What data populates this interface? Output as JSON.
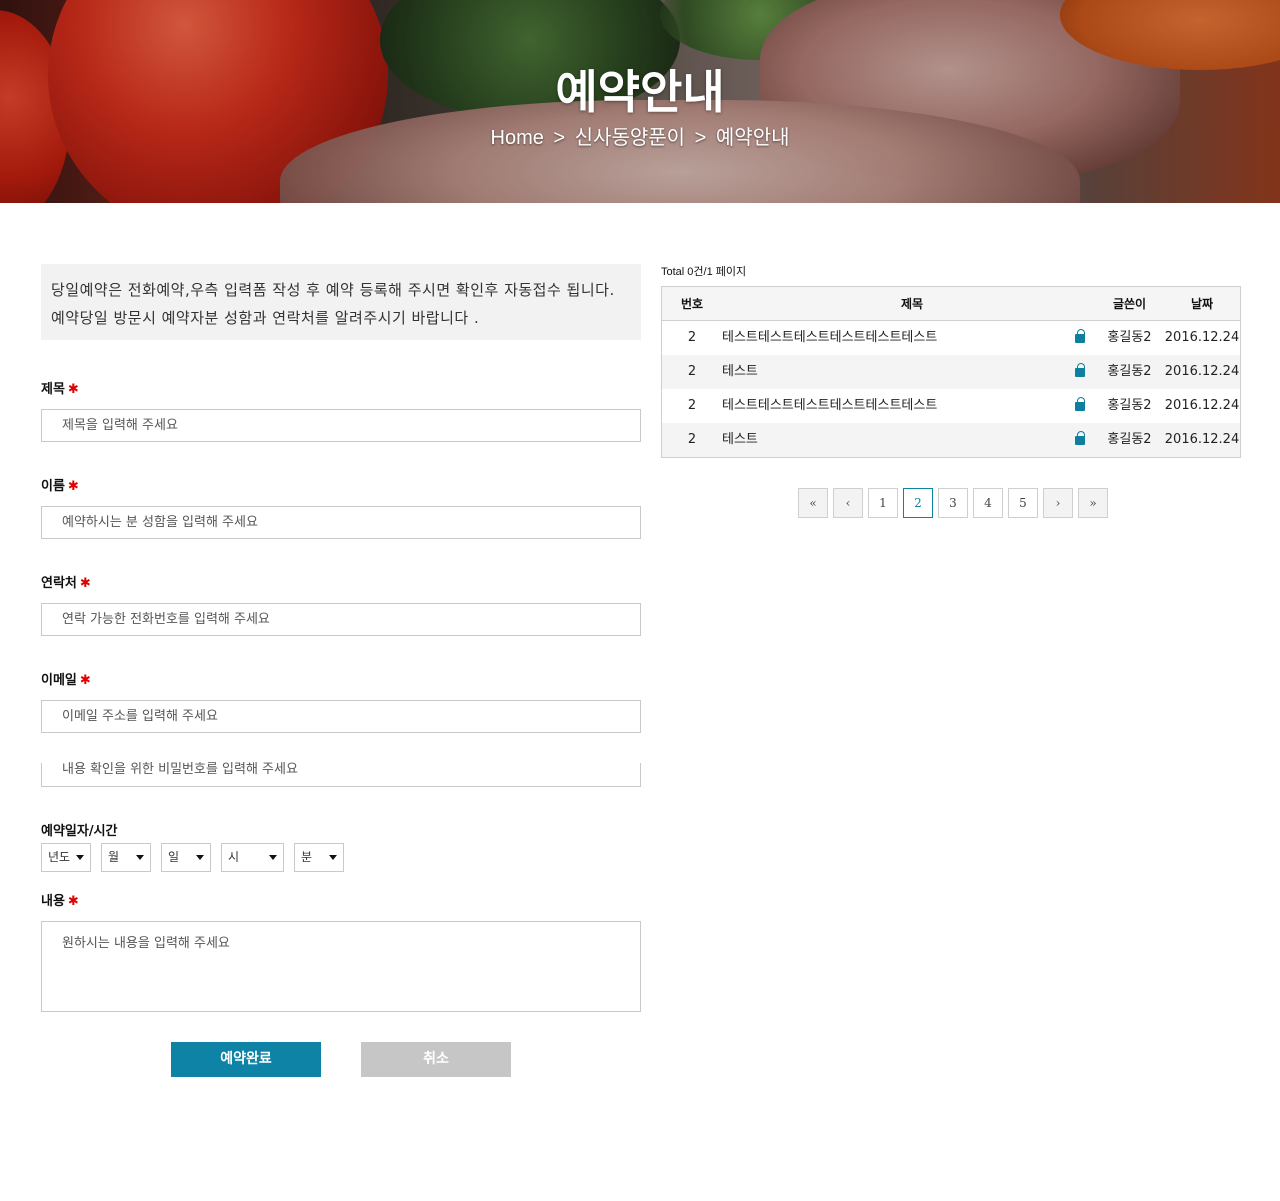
{
  "hero": {
    "title": "예약안내",
    "breadcrumb": [
      "Home",
      ">",
      "신사동양푼이",
      ">",
      "예약안내"
    ]
  },
  "notice": "당일예약은 전화예약,우측 입력폼 작성 후 예약 등록해 주시면 확인후 자동접수 됩니다. 예약당일 방문시 예약자분 성함과 연락처를 알려주시기 바랍니다 .",
  "form": {
    "title_label": "제목",
    "title_placeholder": "제목을 입력해 주세요",
    "name_label": "이름",
    "name_placeholder": "예약하시는 분 성함을 입력해 주세요",
    "phone_label": "연락처",
    "phone_placeholder": "연락 가능한 전화번호를 입력해 주세요",
    "email_label": "이메일",
    "email_placeholder": "이메일 주소를 입력해 주세요",
    "password_placeholder": "내용 확인을 위한 비밀번호를 입력해 주세요",
    "datetime_label": "예약일자/시간",
    "selects": {
      "year": "년도",
      "month": "월",
      "day": "일",
      "hour": "시",
      "minute": "분"
    },
    "content_label": "내용",
    "content_placeholder": "원하시는 내용을 입력해 주세요",
    "required_mark": "✱",
    "submit_label": "예약완료",
    "cancel_label": "취소"
  },
  "board": {
    "total": "Total 0건/1 페이지",
    "columns": {
      "no": "번호",
      "title": "제목",
      "writer": "글쓴이",
      "date": "날짜"
    },
    "rows": [
      {
        "no": "2",
        "title": "테스트테스트테스트테스트테스트테스트",
        "writer": "홍길동2",
        "date": "2016.12.24",
        "locked": true
      },
      {
        "no": "2",
        "title": "테스트",
        "writer": "홍길동2",
        "date": "2016.12.24",
        "locked": true
      },
      {
        "no": "2",
        "title": "테스트테스트테스트테스트테스트테스트",
        "writer": "홍길동2",
        "date": "2016.12.24",
        "locked": true
      },
      {
        "no": "2",
        "title": "테스트",
        "writer": "홍길동2",
        "date": "2016.12.24",
        "locked": true
      }
    ]
  },
  "pagination": {
    "first": "«",
    "prev": "‹",
    "pages": [
      "1",
      "2",
      "3",
      "4",
      "5"
    ],
    "current": "2",
    "next": "›",
    "last": "»"
  },
  "colors": {
    "accent": "#0e83a6",
    "required": "#e00000",
    "cancel": "#c6c6c6"
  }
}
